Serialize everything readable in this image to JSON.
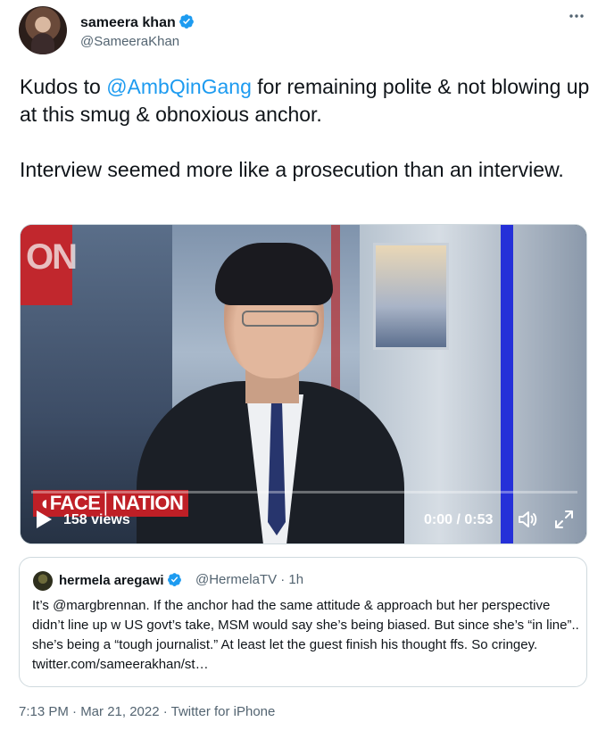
{
  "author": {
    "name": "sameera khan",
    "handle": "@SameeraKhan"
  },
  "tweet": {
    "para1_prefix": "Kudos to ",
    "mention": "@AmbQinGang",
    "para1_suffix": " for remaining polite & not blowing up at this smug & obnoxious anchor.",
    "para2": "Interview seemed more like a prosecution than an interview."
  },
  "video": {
    "overlay_text": "ON",
    "broadcast_bug": "◖FACE│NATION",
    "views": "158 views",
    "time": "0:00 / 0:53",
    "progress": 0
  },
  "quote": {
    "name": "hermela aregawi",
    "handle_time": "@HermelaTV · 1h",
    "text": "It’s @margbrennan. If the anchor had the same attitude & approach but her perspective didn’t line up w US govt’s take, MSM would say she’s being biased. But since she’s “in line”.. she’s being a “tough journalist.” At least let the guest finish his thought ffs. So cringey. twitter.com/sameerakhan/st…"
  },
  "footer": {
    "timestamp": "7:13 PM · Mar 21, 2022 · Twitter for iPhone"
  },
  "colors": {
    "accent": "#1d9bf0",
    "text": "#0f1419",
    "muted": "#536471",
    "border": "#cfd9de"
  },
  "icons": {
    "verified": "verified-badge-icon",
    "more": "more-horizontal-icon",
    "play": "play-icon",
    "volume": "volume-icon",
    "fullscreen": "fullscreen-icon"
  }
}
